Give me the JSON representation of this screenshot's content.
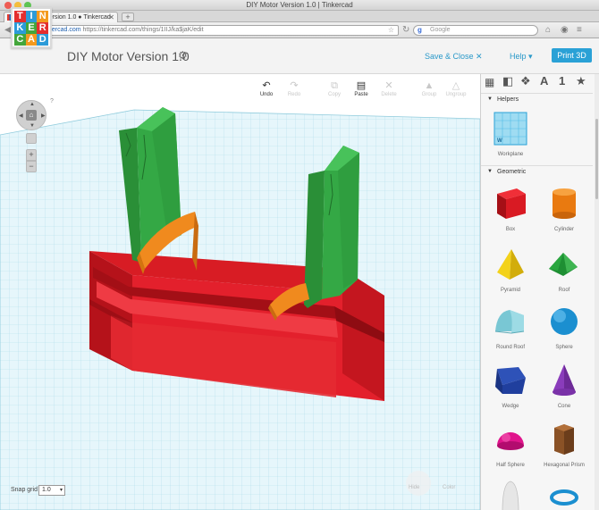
{
  "window": {
    "title": "DIY Motor Version 1.0 | Tinkercad"
  },
  "browser": {
    "tab_label": "DIY Motor Version 1.0 ● Tinkercad",
    "url_host": "tinkercad.com",
    "url_path": "https://tinkercad.com/things/1IIJ/ka$jaK/edit",
    "search_placeholder": "Google"
  },
  "header": {
    "logo_letters": [
      "T",
      "I",
      "N",
      "K",
      "E",
      "R",
      "C",
      "A",
      "D"
    ],
    "doc_title": "DIY Motor Version 1.0",
    "save_close": "Save & Close",
    "help": "Help",
    "print3d": "Print 3D"
  },
  "toolbar": {
    "undo": "Undo",
    "redo": "Redo",
    "copy": "Copy",
    "paste": "Paste",
    "delete": "Delete",
    "group": "Group",
    "ungroup": "Ungroup"
  },
  "view": {
    "help_mark": "?"
  },
  "snap": {
    "label": "Snap grid",
    "value": "1.0"
  },
  "corner": {
    "left": "Hide",
    "right": "Color"
  },
  "sidebar": {
    "tab_letter": "A",
    "tab_number": "1",
    "helpers_title": "Helpers",
    "workplane_label": "Workplane",
    "geometric_title": "Geometric",
    "shapes": [
      {
        "label": "Box"
      },
      {
        "label": "Cylinder"
      },
      {
        "label": "Pyramid"
      },
      {
        "label": "Roof"
      },
      {
        "label": "Round Roof"
      },
      {
        "label": "Sphere"
      },
      {
        "label": "Wedge"
      },
      {
        "label": "Cone"
      },
      {
        "label": "Half Sphere"
      },
      {
        "label": "Hexagonal Prism"
      }
    ]
  },
  "colors": {
    "accent": "#2aa1d6",
    "red": "#e3202c",
    "green": "#2f9e3f",
    "orange": "#ef8a1e"
  }
}
